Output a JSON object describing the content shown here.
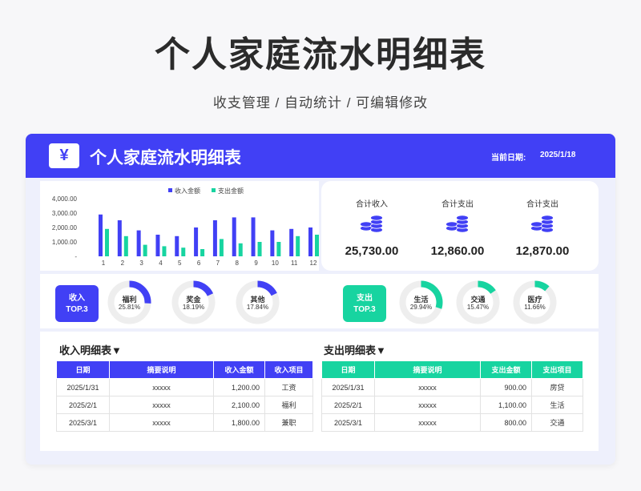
{
  "page": {
    "title": "个人家庭流水明细表",
    "subtitle": "收支管理 / 自动统计 / 可编辑修改"
  },
  "header": {
    "logo": "¥",
    "title": "个人家庭流水明细表",
    "date_label": "当前日期:",
    "date_value": "2025/1/18"
  },
  "colors": {
    "income": "#4140f5",
    "expense": "#17d4a0",
    "header_bg": "#4140f5"
  },
  "chart_data": {
    "type": "bar",
    "categories": [
      "1",
      "2",
      "3",
      "4",
      "5",
      "6",
      "7",
      "8",
      "9",
      "10",
      "11",
      "12"
    ],
    "series": [
      {
        "name": "收入金额",
        "values": [
          2900,
          2500,
          1800,
          1500,
          1400,
          2000,
          2500,
          2700,
          2700,
          1800,
          1900,
          2000
        ]
      },
      {
        "name": "支出金额",
        "values": [
          1900,
          1400,
          800,
          700,
          600,
          500,
          1200,
          900,
          1000,
          1000,
          1400,
          1500
        ]
      }
    ],
    "y_ticks": [
      "4,000.00",
      "3,000.00",
      "2,000.00",
      "1,000.00",
      "-"
    ],
    "ylim": [
      0,
      4000
    ],
    "legend": "top"
  },
  "totals": [
    {
      "label": "合计收入",
      "value": "25,730.00",
      "icon": "coins-icon"
    },
    {
      "label": "合计支出",
      "value": "12,860.00",
      "icon": "coins-icon"
    },
    {
      "label": "合计支出",
      "value": "12,870.00",
      "icon": "coins-icon"
    }
  ],
  "income_top": {
    "badge_line1": "收入",
    "badge_line2": "TOP.3",
    "items": [
      {
        "label": "福利",
        "pct_text": "25.81%",
        "pct": 0.2581
      },
      {
        "label": "奖金",
        "pct_text": "18.19%",
        "pct": 0.1819
      },
      {
        "label": "其他",
        "pct_text": "17.84%",
        "pct": 0.1784
      }
    ]
  },
  "expense_top": {
    "badge_line1": "支出",
    "badge_line2": "TOP.3",
    "items": [
      {
        "label": "生活",
        "pct_text": "29.94%",
        "pct": 0.2994
      },
      {
        "label": "交通",
        "pct_text": "15.47%",
        "pct": 0.1547
      },
      {
        "label": "医疗",
        "pct_text": "11.66%",
        "pct": 0.1166
      }
    ]
  },
  "income_table": {
    "title": "收入明细表▼",
    "headers": [
      "日期",
      "摘要说明",
      "收入金额",
      "收入项目"
    ],
    "rows": [
      [
        "2025/1/31",
        "xxxxx",
        "1,200.00",
        "工资"
      ],
      [
        "2025/2/1",
        "xxxxx",
        "2,100.00",
        "福利"
      ],
      [
        "2025/3/1",
        "xxxxx",
        "1,800.00",
        "兼职"
      ]
    ]
  },
  "expense_table": {
    "title": "支出明细表▼",
    "headers": [
      "日期",
      "摘要说明",
      "支出金额",
      "支出项目"
    ],
    "rows": [
      [
        "2025/1/31",
        "xxxxx",
        "900.00",
        "房贷"
      ],
      [
        "2025/2/1",
        "xxxxx",
        "1,100.00",
        "生活"
      ],
      [
        "2025/3/1",
        "xxxxx",
        "800.00",
        "交通"
      ]
    ]
  }
}
